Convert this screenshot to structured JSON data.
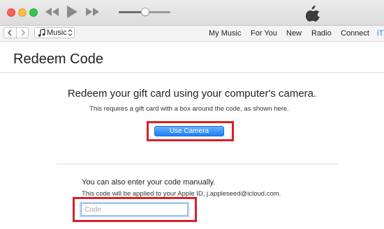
{
  "toolbar": {
    "traffic_lights": {
      "close_color": "#fc605b",
      "minimize_color": "#fdbc40",
      "maximize_color": "#34c84a"
    },
    "icons": {
      "rewind": "rewind-icon",
      "play": "play-icon",
      "fast_forward": "fast-forward-icon",
      "apple": "apple-logo-icon"
    },
    "volume_level": 0.52
  },
  "navbar": {
    "media_selector": "Music",
    "tabs": [
      {
        "label": "My Music"
      },
      {
        "label": "For You"
      },
      {
        "label": "New"
      },
      {
        "label": "Radio"
      },
      {
        "label": "Connect"
      },
      {
        "label": "iT"
      }
    ],
    "active_tab_color": "#1a82fb"
  },
  "page": {
    "title": "Redeem Code",
    "camera_section": {
      "heading": "Redeem your gift card using your computer's camera.",
      "subtext": "This requires a gift card with a box around the code, as shown here.",
      "button_label": "Use Camera"
    },
    "manual_section": {
      "heading": "You can also enter your code manually.",
      "subtext": "This code will be applied to your Apple ID, j.appleseed@icloud.com.",
      "input_placeholder": "Code",
      "input_value": ""
    }
  },
  "highlight_color": "#d8202a",
  "accent_color": "#1a7ff7"
}
